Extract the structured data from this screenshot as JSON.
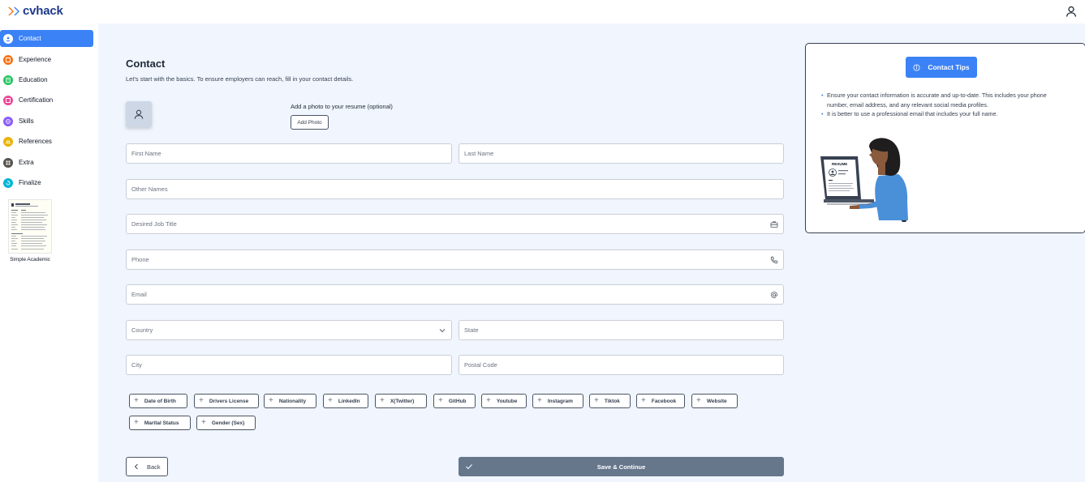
{
  "app": {
    "name": "cvhack"
  },
  "sidebar": {
    "items": [
      {
        "label": "Contact",
        "color": "#60a5fa",
        "active": true
      },
      {
        "label": "Experience",
        "color": "#f97316"
      },
      {
        "label": "Education",
        "color": "#22c55e"
      },
      {
        "label": "Certification",
        "color": "#ec4899"
      },
      {
        "label": "Skills",
        "color": "#8b5cf6"
      },
      {
        "label": "References",
        "color": "#eab308"
      },
      {
        "label": "Extra",
        "color": "#57534e"
      },
      {
        "label": "Finalize",
        "color": "#06b6d4"
      }
    ],
    "template_name": "Simple Academic"
  },
  "main": {
    "title": "Contact",
    "subtitle": "Let's start with the basics. To ensure employers can reach, fill in your contact details.",
    "photo": {
      "label": "Add a photo to your resume (optional)",
      "button": "Add Photo"
    },
    "fields": {
      "first_name": "First Name",
      "last_name": "Last Name",
      "other_names": "Other Names",
      "job_title": "Desired Job Title",
      "phone": "Phone",
      "email": "Email",
      "country": "Country",
      "state": "State",
      "city": "City",
      "postal_code": "Postal Code"
    },
    "chips": [
      "Date of Birth",
      "Drivers License",
      "Nationality",
      "LinkedIn",
      "X(Twitter)",
      "GitHub",
      "Youtube",
      "Instagram",
      "Tiktok",
      "Facebook",
      "Website",
      "Marital Status",
      "Gender (Sex)"
    ],
    "back_label": "Back",
    "save_label": "Save & Continue"
  },
  "tips": {
    "button": "Contact Tips",
    "items": [
      "Ensure your contact information is accurate and up-to-date. This includes your phone number, email address, and any relevant social media profiles.",
      "It is better to use a professional email that includes your full name."
    ],
    "illustration_heading": "RESUME"
  },
  "colors": {
    "accent": "#3b82f6",
    "save": "#66768b",
    "background": "#f0f5fe"
  }
}
